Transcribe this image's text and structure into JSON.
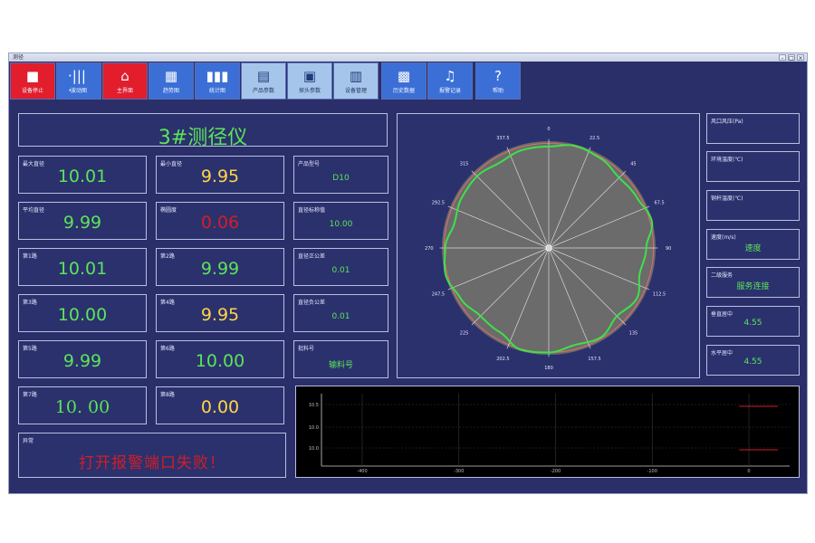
{
  "window": {
    "title": "测径"
  },
  "toolbar": [
    {
      "label": "设备停止",
      "icon": "■",
      "style": "red"
    },
    {
      "label": "波动图",
      "icon": "·|||·",
      "style": "blue"
    },
    {
      "label": "主界面",
      "icon": "⌂",
      "style": "red"
    },
    {
      "label": "趋势图",
      "icon": "▦",
      "style": "blue"
    },
    {
      "label": "统计图",
      "icon": "▮▮▮",
      "style": "blue"
    },
    {
      "label": "产品参数",
      "icon": "▤",
      "style": "light"
    },
    {
      "label": "探头参数",
      "icon": "▣",
      "style": "light"
    },
    {
      "label": "设备管理",
      "icon": "▥",
      "style": "light"
    },
    {
      "label": "历史数据",
      "icon": "▩",
      "style": "blue"
    },
    {
      "label": "报警记录",
      "icon": "♫",
      "style": "blue"
    },
    {
      "label": "帮助",
      "icon": "?",
      "style": "blue"
    }
  ],
  "main": {
    "title": "3#测径仪",
    "max_label": "最大直径",
    "max_value": "10.01",
    "min_label": "最小直径",
    "min_value": "9.95",
    "avg_label": "平均直径",
    "avg_value": "9.99",
    "ovality_label": "椭圆度",
    "ovality_value": "0.06",
    "ch1_label": "第1路",
    "ch1_value": "10.01",
    "ch2_label": "第2路",
    "ch2_value": "9.99",
    "ch3_label": "第3路",
    "ch3_value": "10.00",
    "ch4_label": "第4路",
    "ch4_value": "9.95",
    "ch5_label": "第5路",
    "ch5_value": "9.99",
    "ch6_label": "第6路",
    "ch6_value": "10.00",
    "ch7_label": "第7路",
    "ch7_value": "10. 00",
    "ch8_label": "第8路",
    "ch8_value": "0.00",
    "alarm_label": "异常",
    "alarm_text": "打开报警端口失败！"
  },
  "params": {
    "model_label": "产品型号",
    "model_value": "D10",
    "nominal_label": "直径标称值",
    "nominal_value": "10.00",
    "upper_label": "直径正公差",
    "upper_value": "0.01",
    "lower_label": "直径负公差",
    "lower_value": "0.01",
    "batch_label": "批料号",
    "batch_value": "输料号"
  },
  "right": {
    "pressure_label": "风口风压(Pa)",
    "pressure_value": "",
    "env_label": "环境温度(℃)",
    "env_value": "",
    "temp_label": "铜杆温度(℃)",
    "temp_value": "",
    "speed_label": "速度(m/s)",
    "speed_value": "速度",
    "net_label": "二级服务",
    "net_value": "服务连接",
    "vcenter_label": "垂直居中",
    "vcenter_value": "4.55",
    "hcenter_label": "水平居中",
    "hcenter_value": "4.55"
  },
  "chart_data": [
    {
      "type": "line",
      "subtype": "polar",
      "title": "",
      "angle_labels": [
        "0",
        "22.5",
        "45",
        "67.5",
        "90",
        "112.5",
        "135",
        "157.5",
        "180",
        "202.5",
        "225",
        "247.5",
        "270",
        "292.5",
        "315",
        "337.5"
      ],
      "radial_shape": [
        1.0,
        1.04,
        1.02,
        0.98,
        1.0,
        1.05,
        0.96,
        0.93,
        1.0,
        0.95,
        1.02,
        0.99,
        1.03,
        1.04,
        0.96,
        0.95,
        1.0,
        1.05,
        1.02,
        0.96,
        0.99,
        1.0,
        0.97,
        1.0
      ],
      "colors": {
        "curve": "#3fe04a",
        "fill": "#6b6b6b",
        "reference": "#ff6b6b"
      }
    },
    {
      "type": "line",
      "title": "",
      "x_ticks": [
        "-400",
        "-300",
        "-200",
        "-100",
        "0"
      ],
      "y_ticks": [
        "10.5",
        "10.0",
        "10.0"
      ],
      "xlim": [
        -400,
        0
      ],
      "series": [
        {
          "values": [
            10.5,
            10.5
          ],
          "x": [
            -10,
            30
          ],
          "color": "#d11e28"
        },
        {
          "values": [
            10.0,
            10.0
          ],
          "x": [
            -10,
            30
          ],
          "color": "#d11e28"
        }
      ]
    }
  ]
}
